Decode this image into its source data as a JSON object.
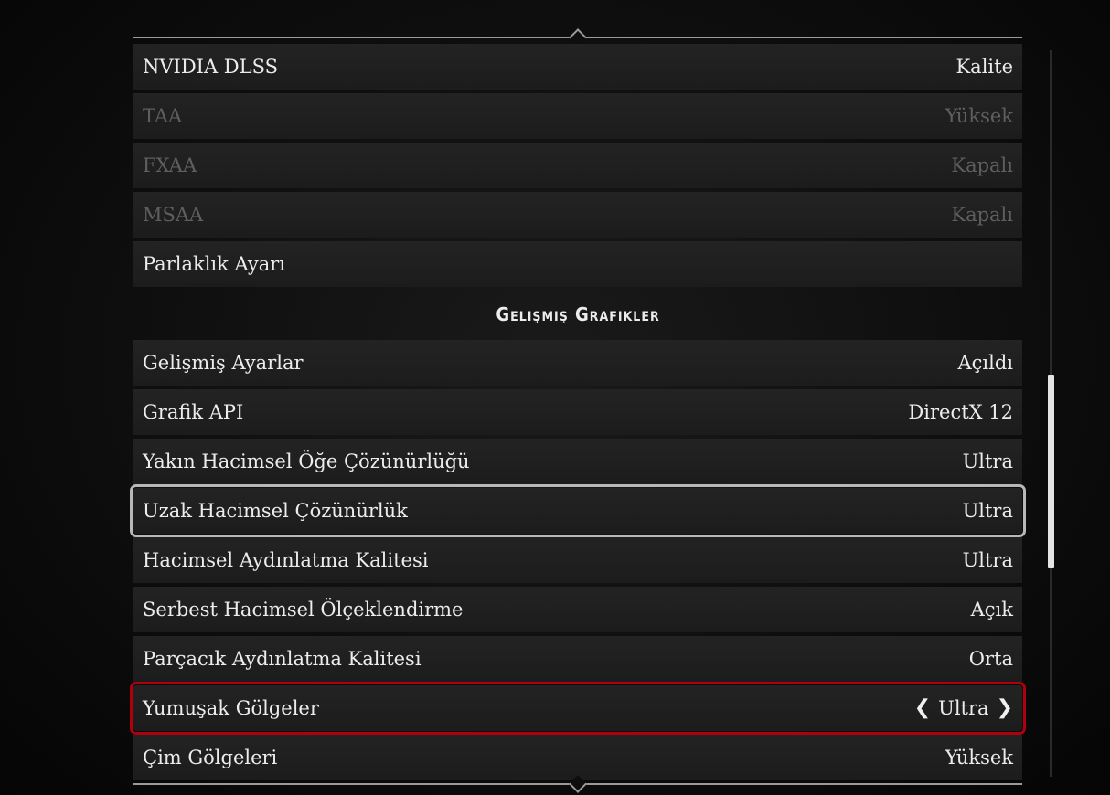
{
  "section_header": "Gelişmiş Grafikler",
  "rows_top": [
    {
      "label": "NVIDIA DLSS",
      "value": "Kalite",
      "disabled": false
    },
    {
      "label": "TAA",
      "value": "Yüksek",
      "disabled": true
    },
    {
      "label": "FXAA",
      "value": "Kapalı",
      "disabled": true
    },
    {
      "label": "MSAA",
      "value": "Kapalı",
      "disabled": true
    },
    {
      "label": "Parlaklık Ayarı",
      "value": "",
      "disabled": false
    }
  ],
  "rows_advanced": [
    {
      "label": "Gelişmiş Ayarlar",
      "value": "Açıldı"
    },
    {
      "label": "Grafik API",
      "value": "DirectX 12"
    },
    {
      "label": "Yakın Hacimsel Öğe Çözünürlüğü",
      "value": "Ultra"
    },
    {
      "label": "Uzak Hacimsel Çözünürlük",
      "value": "Ultra",
      "state": "focused"
    },
    {
      "label": "Hacimsel Aydınlatma Kalitesi",
      "value": "Ultra"
    },
    {
      "label": "Serbest Hacimsel Ölçeklendirme",
      "value": "Açık"
    },
    {
      "label": "Parçacık Aydınlatma Kalitesi",
      "value": "Orta"
    },
    {
      "label": "Yumuşak Gölgeler",
      "value": "Ultra",
      "state": "selected"
    },
    {
      "label": "Çim Gölgeleri",
      "value": "Yüksek"
    }
  ],
  "icons": {
    "prev": "chevron-left-icon",
    "next": "chevron-right-icon"
  },
  "colors": {
    "selected_border": "#b0000d",
    "focused_border": "#b8b8b8",
    "disabled_text": "#5f5f5f"
  }
}
